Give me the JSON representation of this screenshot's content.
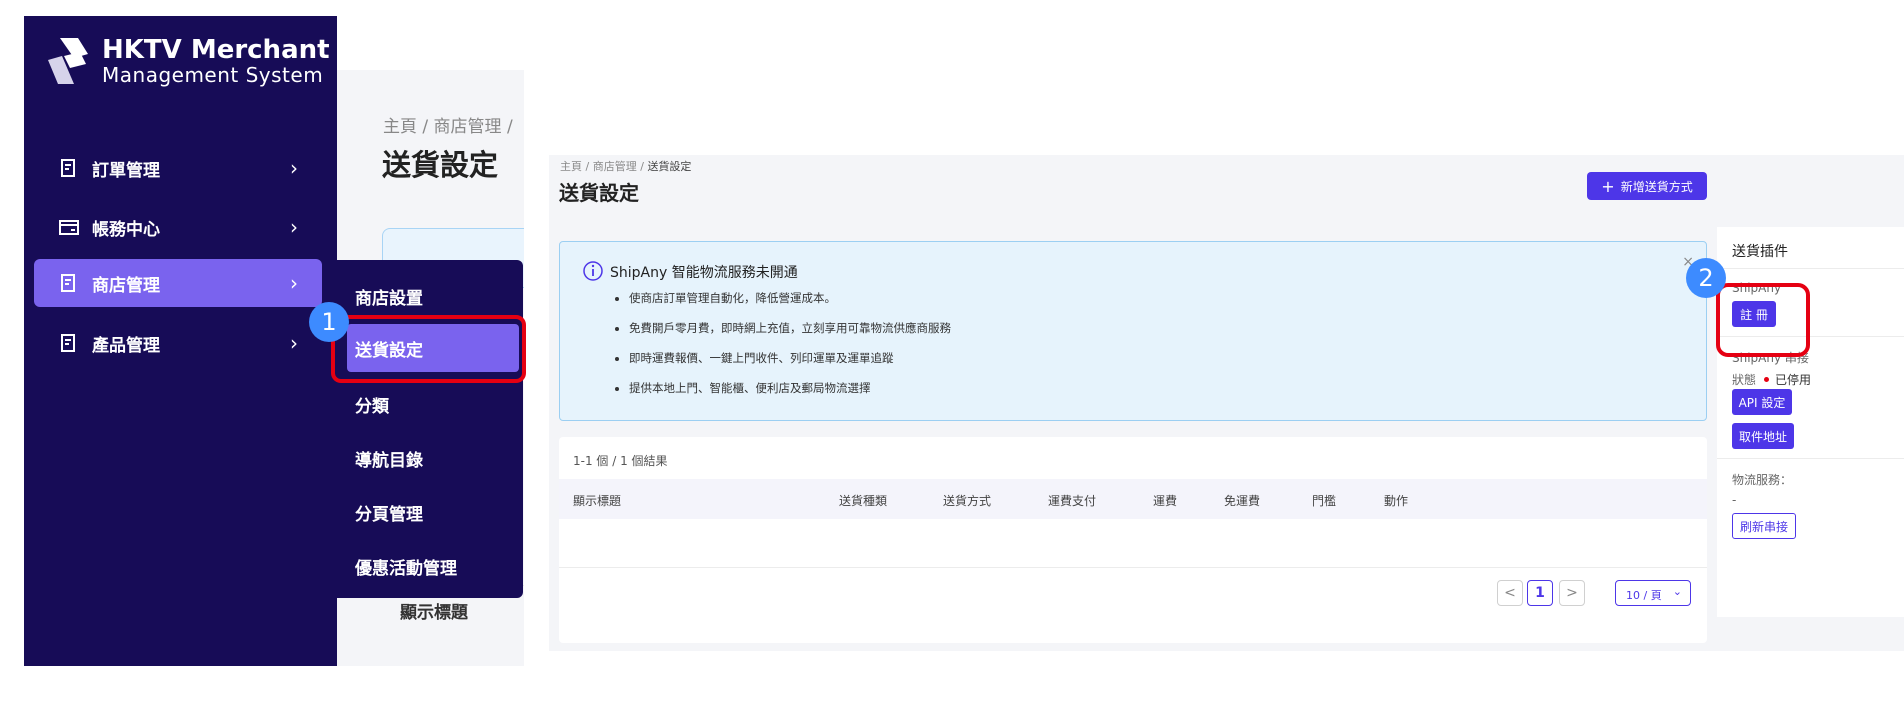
{
  "logo": {
    "title": "HKTV Merchant",
    "subtitle": "Management System"
  },
  "sidebar": {
    "items": [
      {
        "label": "訂單管理",
        "icon": "document-icon"
      },
      {
        "label": "帳務中心",
        "icon": "wallet-icon"
      },
      {
        "label": "商店管理",
        "icon": "document-icon",
        "active": true
      },
      {
        "label": "產品管理",
        "icon": "document-icon"
      }
    ]
  },
  "submenu": {
    "items": [
      "商店設置",
      "送貨設定",
      "分類",
      "導航目錄",
      "分頁管理",
      "優惠活動管理"
    ],
    "active": "送貨設定"
  },
  "background": {
    "breadcrumb": "主頁 / 商店管理 /",
    "title": "送貨設定",
    "table_header": "顯示標題"
  },
  "badges": {
    "one": "1",
    "two": "2"
  },
  "main": {
    "breadcrumb": {
      "home": "主頁",
      "shop": "商店管理",
      "current": "送貨設定",
      "sep": "/"
    },
    "title": "送貨設定",
    "add_button": "新增送貨方式",
    "info": {
      "title": "ShipAny 智能物流服務未開通",
      "bullets": [
        "使商店訂單管理自動化，降低營運成本。",
        "免費開戶零月費，即時網上充值，立刻享用可靠物流供應商服務",
        "即時運費報價、一鍵上門收件、列印運單及運單追蹤",
        "提供本地上門、智能櫃、便利店及郵局物流選擇"
      ],
      "close": "×"
    },
    "table": {
      "count": "1-1 個 / 1 個結果",
      "columns": [
        "顯示標題",
        "送貨種類",
        "送貨方式",
        "運費支付",
        "運費",
        "免運費",
        "門檻",
        "動作"
      ],
      "pagination": {
        "prev": "<",
        "page": "1",
        "next": ">",
        "per_page": "10 / 頁"
      }
    }
  },
  "side_panel": {
    "title": "送貨插件",
    "shipany_label": "ShipAny",
    "register_button": "註 冊",
    "integration_label": "ShipAny 串接",
    "status_label": "狀態",
    "status_value": "已停用",
    "api_button": "API 設定",
    "pickup_button": "取件地址",
    "logistics_label": "物流服務：",
    "logistics_value": "-",
    "refresh_button": "刷新串接"
  },
  "colors": {
    "sidebar_bg": "#170c57",
    "active_bg": "#7a63ee",
    "primary": "#4d36e8",
    "highlight": "#e50012",
    "badge": "#3d8bff"
  }
}
